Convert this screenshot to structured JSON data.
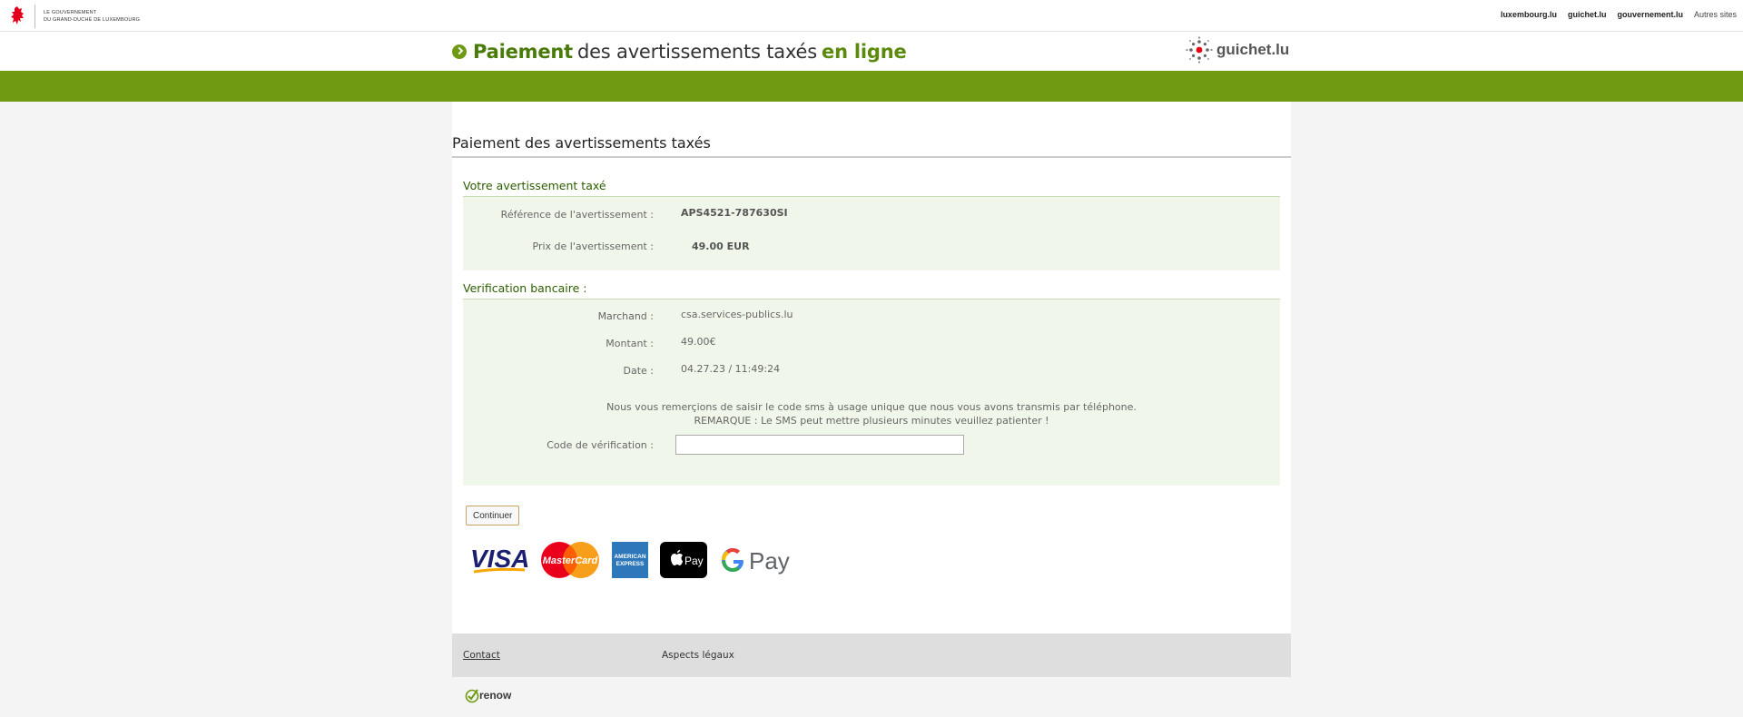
{
  "topbar": {
    "gov_line1": "Le Gouvernement",
    "gov_line2": "du Grand-Duché de Luxembourg",
    "links": [
      "luxembourg.lu",
      "guichet.lu",
      "gouvernement.lu",
      "Autres sites"
    ]
  },
  "header": {
    "title_part1": "Paiement",
    "title_part2": "des avertissements taxés",
    "title_part3": "en ligne",
    "logo_text": "guichet.lu"
  },
  "colors": {
    "brand_green": "#6f9a12",
    "panel_bg": "#f0f7ea",
    "section_title": "#2c5e00"
  },
  "main": {
    "page_title": "Paiement des avertissements taxés",
    "avertissement": {
      "section_title": "Votre avertissement taxé",
      "reference_label": "Référence de l'avertissement :",
      "reference_value": "APS4521-787630SI",
      "prix_label": "Prix de l'avertissement :",
      "prix_value": "49.00 EUR"
    },
    "verification": {
      "section_title": "Verification bancaire :",
      "marchand_label": "Marchand :",
      "marchand_value": "csa.services-publics.lu",
      "montant_label": "Montant :",
      "montant_value": "49.00€",
      "date_label": "Date :",
      "date_value": "04.27.23 / 11:49:24",
      "note_line1": "Nous vous remerçions de saisir le code sms à usage unique que nous vous avons transmis par téléphone.",
      "note_line2": "REMARQUE : Le SMS peut mettre plusieurs minutes veuillez patienter !",
      "code_label": "Code de vérification :",
      "code_value": "",
      "code_placeholder": ""
    },
    "continue_label": "Continuer",
    "payment_methods": {
      "visa": "VISA",
      "mastercard": "MasterCard",
      "amex_line1": "AMERICAN",
      "amex_line2": "EXPRESS",
      "applepay": "Pay",
      "gpay": "Pay"
    }
  },
  "footer": {
    "contact": "Contact",
    "legal": "Aspects légaux",
    "renow": "renow"
  }
}
